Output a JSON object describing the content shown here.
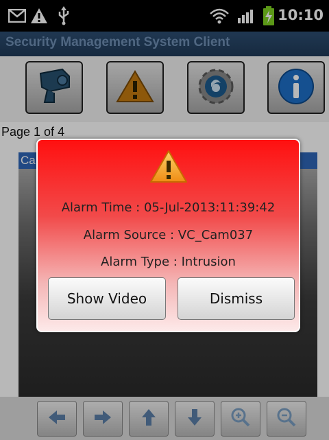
{
  "status_bar": {
    "time": "10:10",
    "icons": [
      "mail-icon",
      "warning-icon",
      "usb-icon",
      "wifi-icon",
      "signal-icon",
      "battery-charging-icon"
    ]
  },
  "app": {
    "title": "Security Management System Client"
  },
  "toolbar": {
    "buttons": [
      {
        "icon": "camera-icon"
      },
      {
        "icon": "alarm-icon"
      },
      {
        "icon": "settings-icon"
      },
      {
        "icon": "info-icon"
      }
    ]
  },
  "page_indicator": "Page 1 of 4",
  "camera": {
    "label": "Ca"
  },
  "bottom_controls": {
    "buttons": [
      {
        "icon": "arrow-left-icon"
      },
      {
        "icon": "arrow-right-icon"
      },
      {
        "icon": "arrow-up-icon"
      },
      {
        "icon": "arrow-down-icon"
      },
      {
        "icon": "zoom-in-icon"
      },
      {
        "icon": "zoom-out-icon"
      }
    ]
  },
  "alarm_dialog": {
    "icon": "warning-icon",
    "alarm_time": "Alarm Time : 05-Jul-2013:11:39:42",
    "alarm_source": "Alarm Source : VC_Cam037",
    "alarm_type": "Alarm Type : Intrusion",
    "show_video_label": "Show Video",
    "dismiss_label": "Dismiss"
  },
  "colors": {
    "title_bar": "#1f3a58",
    "dialog_top": "#ff1010",
    "camera_label": "#2f66b8",
    "warning": "#f5a623"
  }
}
